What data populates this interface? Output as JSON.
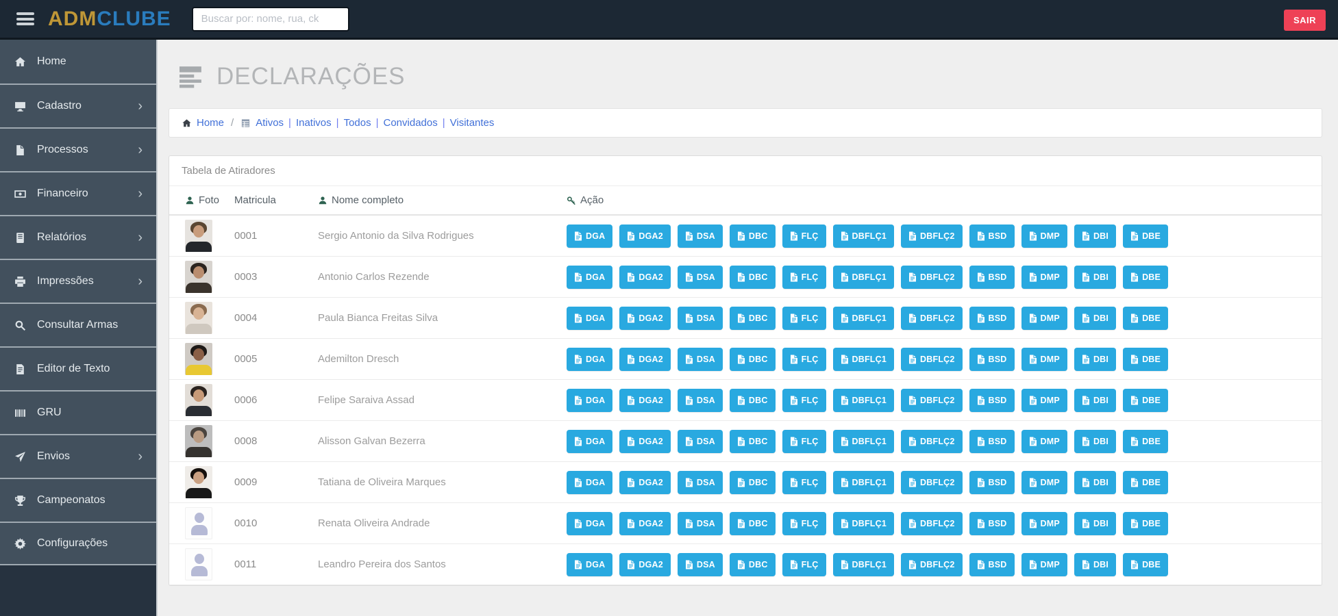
{
  "colors": {
    "topbar_bg": "#1c2834",
    "topbar_edge": "#10181f",
    "sidebar_bg": "#26323f",
    "item_bg": "#42505d",
    "separator": "#9fa9b1",
    "item_text": "#e6ebee",
    "content_bg": "#efefef",
    "panel_border": "#dcdcdc",
    "title_gray": "#b3b5b7",
    "icon_gray": "#a6aaad",
    "link_blue": "#4170d8",
    "header_green": "#2e6351",
    "accent_blue": "#29a9e0",
    "sair_red": "#ee4156",
    "logo_gold": "#bf9737",
    "logo_blue": "#2a7cbd",
    "name_gray": "#9c9c9c",
    "colhead_gray": "#555f66"
  },
  "topbar": {
    "logo_adm": "ADM",
    "logo_clube": "CLUBE",
    "search_placeholder": "Buscar por: nome, rua, ck",
    "sair_label": "SAIR"
  },
  "sidebar": {
    "items": [
      {
        "label": "Home",
        "icon": "home-icon",
        "expandable": false
      },
      {
        "label": "Cadastro",
        "icon": "desktop-icon",
        "expandable": true
      },
      {
        "label": "Processos",
        "icon": "file-icon",
        "expandable": true
      },
      {
        "label": "Financeiro",
        "icon": "money-icon",
        "expandable": true
      },
      {
        "label": "Relatórios",
        "icon": "book-icon",
        "expandable": true
      },
      {
        "label": "Impressões",
        "icon": "printer-icon",
        "expandable": true
      },
      {
        "label": "Consultar Armas",
        "icon": "search-icon",
        "expandable": false
      },
      {
        "label": "Editor de Texto",
        "icon": "doc-text-icon",
        "expandable": false
      },
      {
        "label": "GRU",
        "icon": "barcode-icon",
        "expandable": false
      },
      {
        "label": "Envios",
        "icon": "send-icon",
        "expandable": true
      },
      {
        "label": "Campeonatos",
        "icon": "trophy-icon",
        "expandable": false
      },
      {
        "label": "Configurações",
        "icon": "gear-icon",
        "expandable": false
      }
    ]
  },
  "page": {
    "title": "DECLARAÇÕES"
  },
  "breadcrumb": {
    "home_label": "Home",
    "separator": "/",
    "filters": [
      "Ativos",
      "Inativos",
      "Todos",
      "Convidados",
      "Visitantes"
    ],
    "filter_separator": "|"
  },
  "table": {
    "panel_title": "Tabela de Atiradores",
    "columns": [
      "Foto",
      "Matricula",
      "Nome completo",
      "Ação"
    ],
    "doc_buttons": [
      "DGA",
      "DGA2",
      "DSA",
      "DBC",
      "FLÇ",
      "DBFLÇ1",
      "DBFLÇ2",
      "BSD",
      "DMP",
      "DBI",
      "DBE"
    ],
    "rows": [
      {
        "matricula": "0001",
        "nome": "Sergio Antonio da Silva Rodrigues",
        "avatar": {
          "type": "photo",
          "bg": "#e6e3df",
          "hair": "#5a4632",
          "skin": "#c89c7c",
          "shirt": "#23262b"
        }
      },
      {
        "matricula": "0003",
        "nome": "Antonio Carlos Rezende",
        "avatar": {
          "type": "photo",
          "bg": "#d8d4cf",
          "hair": "#2b241f",
          "skin": "#b98d6f",
          "shirt": "#3a332c"
        }
      },
      {
        "matricula": "0004",
        "nome": "Paula Bianca Freitas Silva",
        "avatar": {
          "type": "photo",
          "bg": "#e9e3dc",
          "hair": "#8a6b4f",
          "skin": "#d8b394",
          "shirt": "#cfc8bf"
        }
      },
      {
        "matricula": "0005",
        "nome": "Ademilton Dresch",
        "avatar": {
          "type": "photo",
          "bg": "#cfcac4",
          "hair": "#1e1a17",
          "skin": "#8a5f46",
          "shirt": "#e8c832"
        }
      },
      {
        "matricula": "0006",
        "nome": "Felipe Saraiva Assad",
        "avatar": {
          "type": "photo",
          "bg": "#e2ddd7",
          "hair": "#2b2420",
          "skin": "#c79a78",
          "shirt": "#2a2d33"
        }
      },
      {
        "matricula": "0008",
        "nome": "Alisson Galvan Bezerra",
        "avatar": {
          "type": "photo",
          "bg": "#bdbdbd",
          "hair": "#4a443e",
          "skin": "#b99b82",
          "shirt": "#35322f"
        }
      },
      {
        "matricula": "0009",
        "nome": "Tatiana de Oliveira Marques",
        "avatar": {
          "type": "photo",
          "bg": "#efece8",
          "hair": "#15100d",
          "skin": "#caa183",
          "shirt": "#191919"
        }
      },
      {
        "matricula": "0010",
        "nome": "Renata Oliveira Andrade",
        "avatar": {
          "type": "placeholder",
          "silhouette": "#b6bad6"
        }
      },
      {
        "matricula": "0011",
        "nome": "Leandro Pereira dos Santos",
        "avatar": {
          "type": "placeholder",
          "silhouette": "#b6bad6"
        }
      }
    ]
  }
}
